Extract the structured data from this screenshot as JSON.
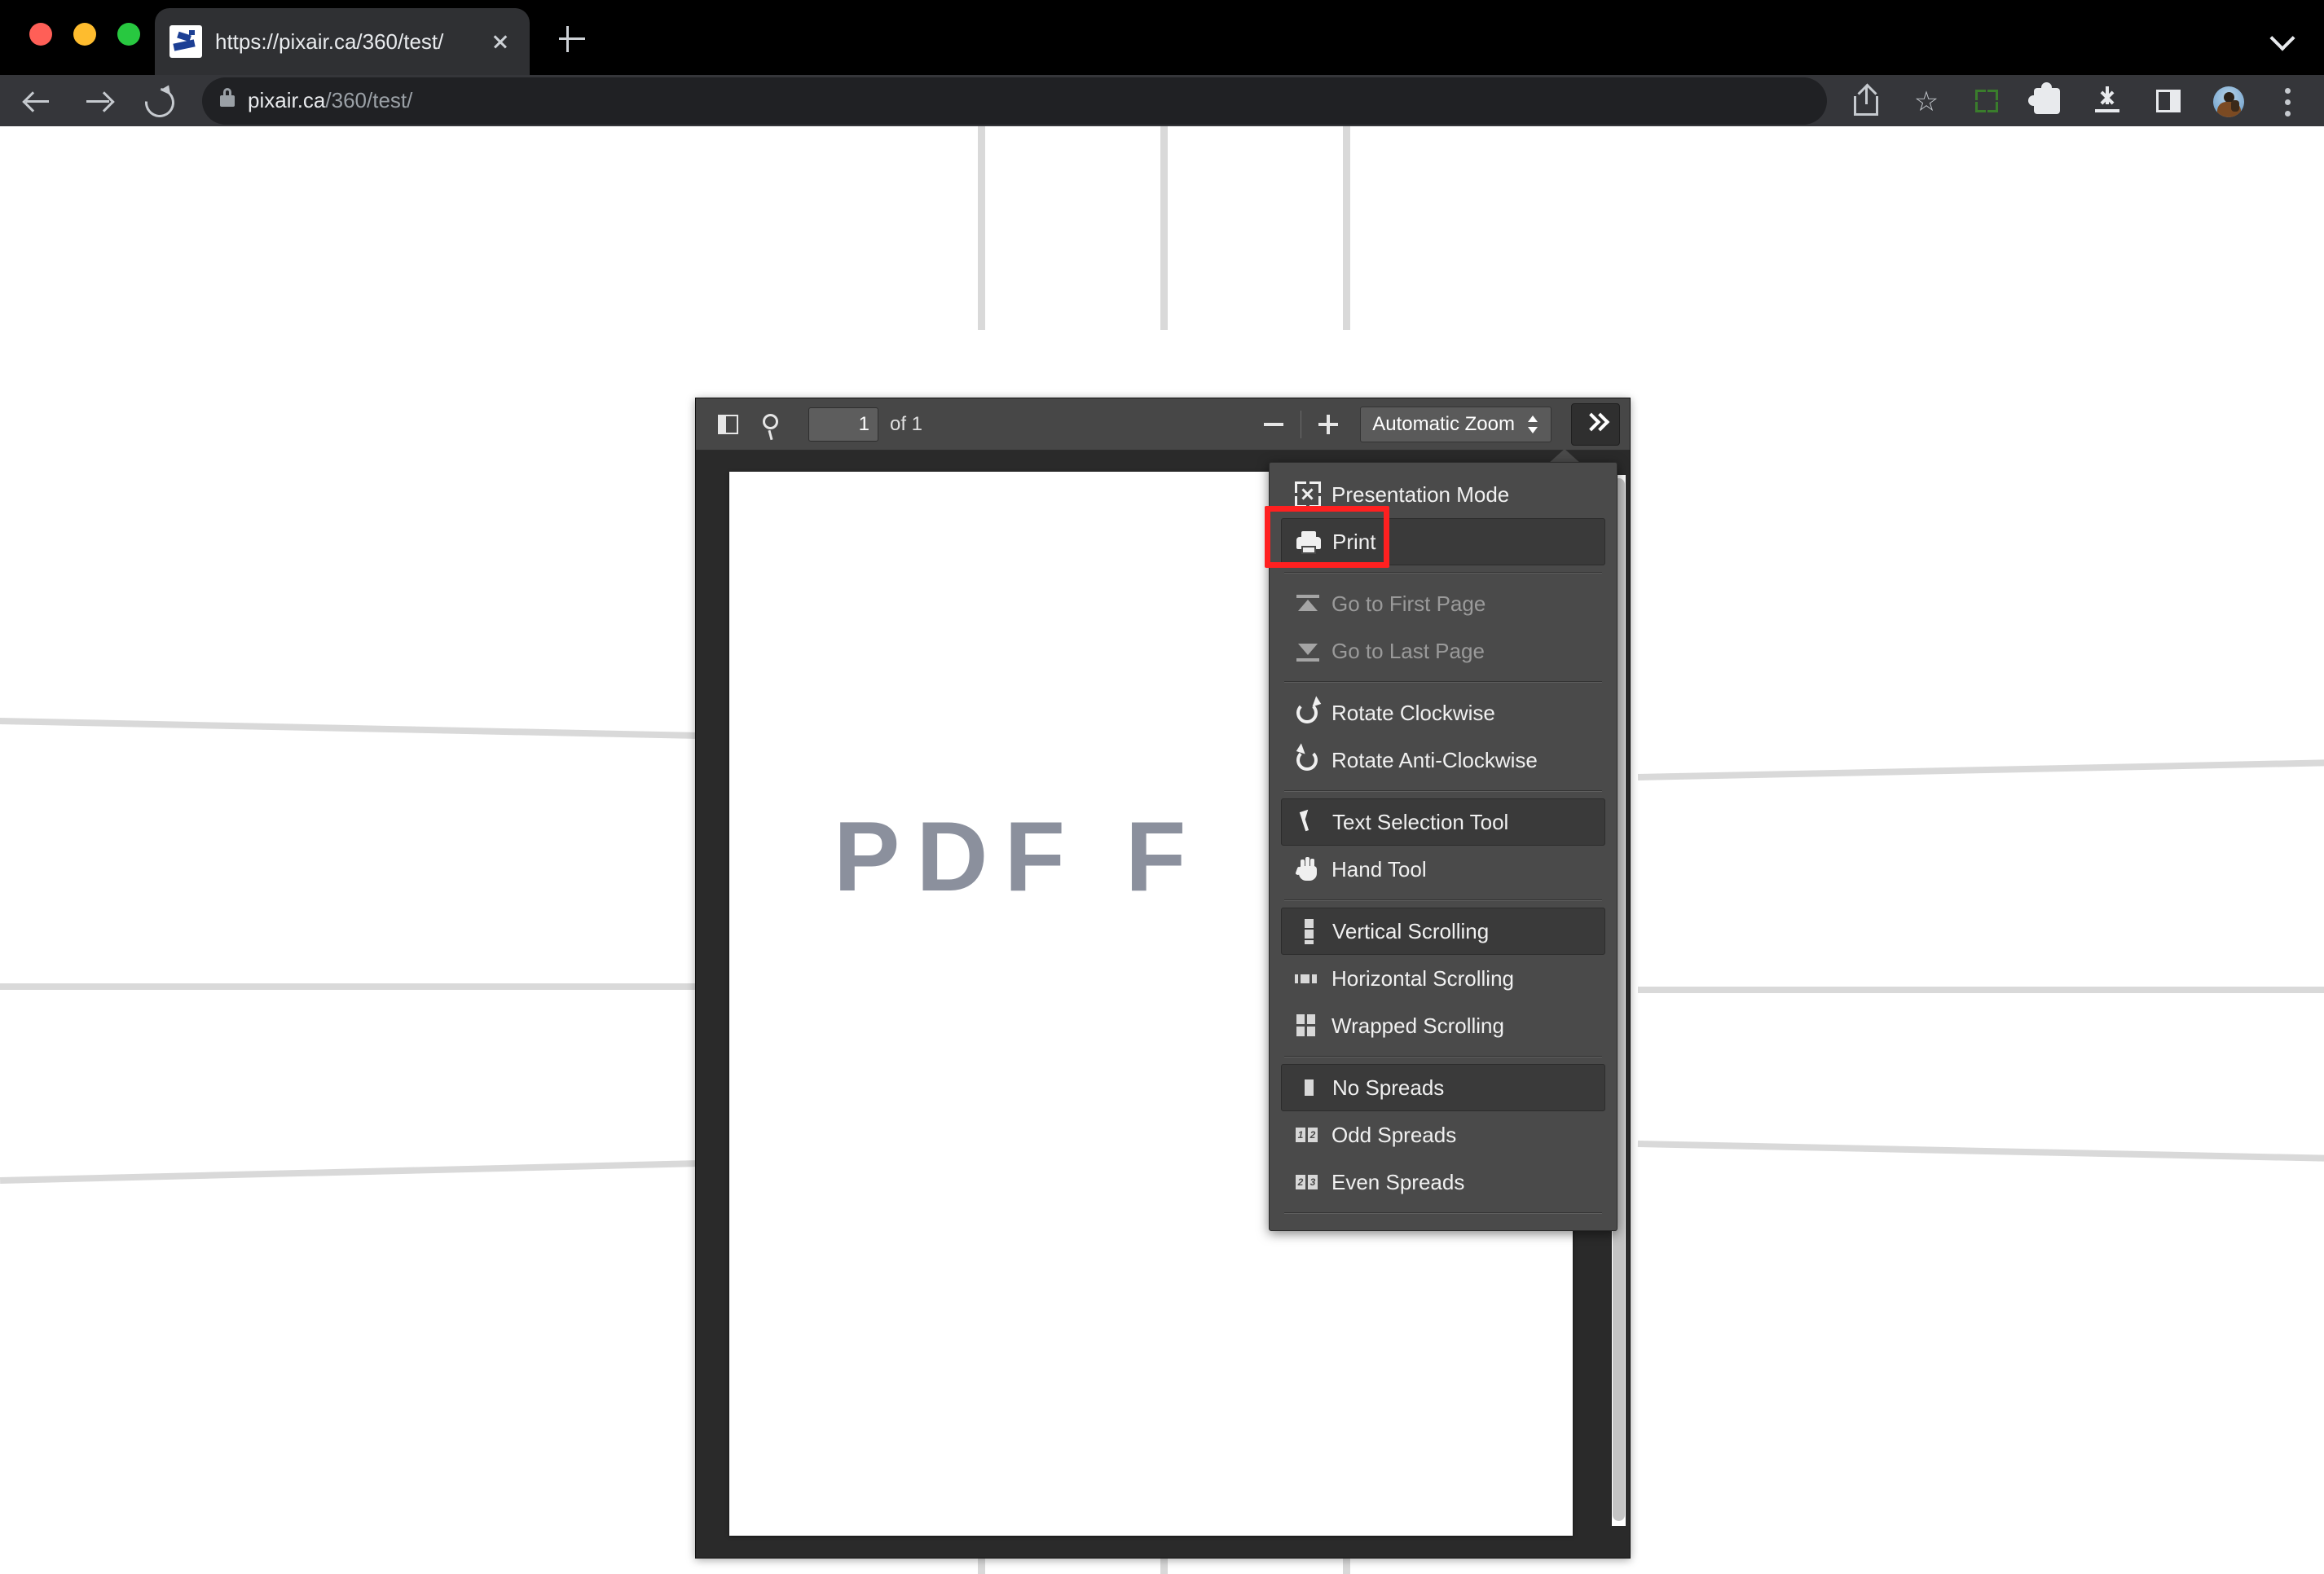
{
  "browser": {
    "tab": {
      "title": "https://pixair.ca/360/test/",
      "favicon": "site-favicon",
      "close_icon": "close-icon"
    },
    "new_tab_icon": "plus-icon",
    "tab_list_icon": "chevron-down-icon",
    "nav": {
      "back_icon": "arrow-left-icon",
      "forward_icon": "arrow-right-icon",
      "reload_icon": "reload-icon"
    },
    "omnibox": {
      "lock_icon": "lock-icon",
      "url_host": "pixair.ca",
      "url_path": "/360/test/"
    },
    "actions": [
      {
        "name": "share-icon",
        "label": "Share"
      },
      {
        "name": "bookmark-star-icon",
        "label": "Bookmark this tab",
        "glyph": "☆"
      },
      {
        "name": "fullscreen-icon",
        "label": "Full screen"
      },
      {
        "name": "extensions-puzzle-icon",
        "label": "Extensions"
      },
      {
        "name": "downloads-icon",
        "label": "Downloads"
      },
      {
        "name": "side-panel-icon",
        "label": "Side panel"
      },
      {
        "name": "profile-avatar",
        "label": "Profile"
      },
      {
        "name": "chrome-menu-kebab-icon",
        "label": "Customize and control"
      }
    ]
  },
  "pdf_toolbar": {
    "sidebar_toggle_label": "Toggle Sidebar",
    "find_label": "Find in Document",
    "page_number": "1",
    "page_count": "of 1",
    "zoom_out_label": "Zoom Out",
    "zoom_in_label": "Zoom In",
    "zoom_level": "Automatic Zoom",
    "more_tools_label": "Tools"
  },
  "pdf_document": {
    "watermark": "PDF F"
  },
  "menu": {
    "groups": [
      {
        "items": [
          {
            "label": "Presentation Mode",
            "icon": "presentation-mode-icon",
            "state": "normal"
          },
          {
            "label": "Print",
            "icon": "print-icon",
            "state": "highlighted"
          }
        ]
      },
      {
        "items": [
          {
            "label": "Go to First Page",
            "icon": "go-to-first-page-icon",
            "state": "disabled"
          },
          {
            "label": "Go to Last Page",
            "icon": "go-to-last-page-icon",
            "state": "disabled"
          }
        ]
      },
      {
        "items": [
          {
            "label": "Rotate Clockwise",
            "icon": "rotate-clockwise-icon",
            "state": "normal"
          },
          {
            "label": "Rotate Anti-Clockwise",
            "icon": "rotate-anti-clockwise-icon",
            "state": "normal"
          }
        ]
      },
      {
        "items": [
          {
            "label": "Text Selection Tool",
            "icon": "text-selection-cursor-icon",
            "state": "selected"
          },
          {
            "label": "Hand Tool",
            "icon": "hand-tool-icon",
            "state": "normal"
          }
        ]
      },
      {
        "items": [
          {
            "label": "Vertical Scrolling",
            "icon": "vertical-scrolling-icon",
            "state": "selected"
          },
          {
            "label": "Horizontal Scrolling",
            "icon": "horizontal-scrolling-icon",
            "state": "normal"
          },
          {
            "label": "Wrapped Scrolling",
            "icon": "wrapped-scrolling-icon",
            "state": "normal"
          }
        ]
      },
      {
        "items": [
          {
            "label": "No Spreads",
            "icon": "no-spreads-icon",
            "state": "selected"
          },
          {
            "label": "Odd Spreads",
            "icon": "odd-spreads-icon",
            "state": "normal",
            "badge_a": "1",
            "badge_b": "2"
          },
          {
            "label": "Even Spreads",
            "icon": "even-spreads-icon",
            "state": "normal",
            "badge_a": "2",
            "badge_b": "3"
          }
        ]
      }
    ]
  },
  "annotation": {
    "highlight_target": "Print",
    "highlight_color": "#ff2020"
  },
  "colors": {
    "chrome_tabstrip": "#000000",
    "chrome_toolbar": "#35363a",
    "omnibox": "#202124",
    "pdf_toolbar": "#474747",
    "pdf_backdrop": "#2a2a2a",
    "menu_bg": "#4a4a4a",
    "menu_selected": "#3a3a3a",
    "watermark": "#8b909d",
    "highlight": "#ff2020"
  }
}
